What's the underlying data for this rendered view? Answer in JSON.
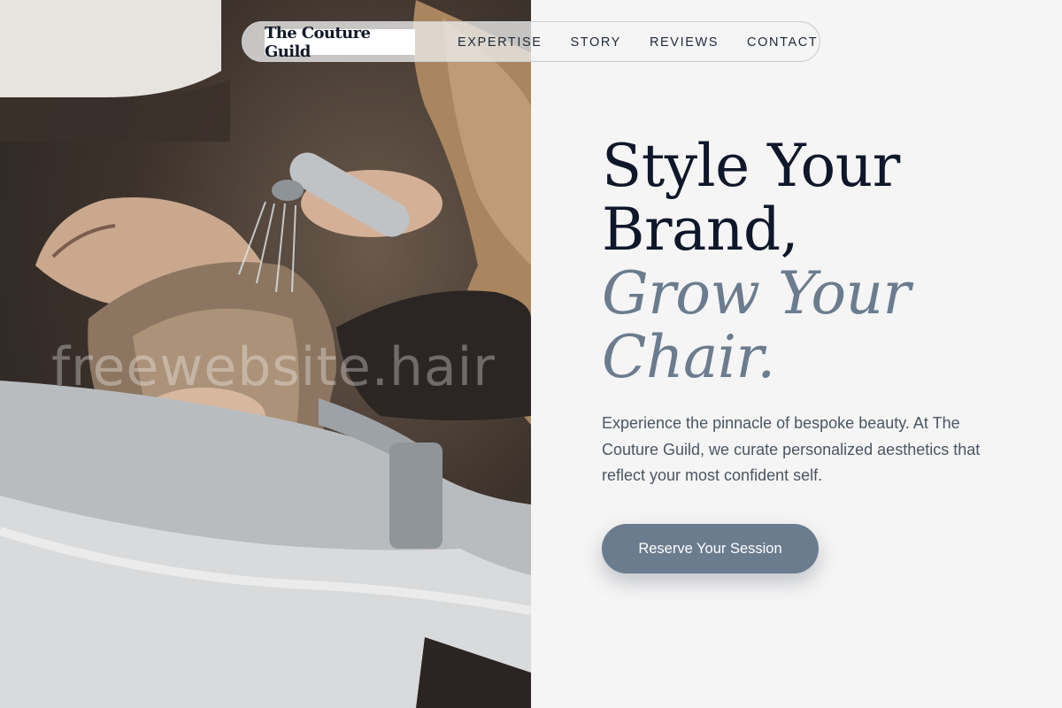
{
  "brand": {
    "name": "The Couture Guild"
  },
  "nav": {
    "links": [
      "EXPERTISE",
      "STORY",
      "REVIEWS",
      "CONTACT"
    ]
  },
  "hero": {
    "headline_line1": "Style Your",
    "headline_line2": "Brand,",
    "headline_accent_line1": "Grow Your",
    "headline_accent_line2": "Chair.",
    "description": "Experience the pinnacle of bespoke beauty. At The Couture Guild, we curate personalized aesthetics that reflect your most confident self.",
    "cta_label": "Reserve Your Session",
    "image_watermark": "freewebsite.hair"
  },
  "colors": {
    "accent": "#6b7c8f",
    "heading": "#0f172a",
    "body_text": "#4b5563",
    "background": "#f5f5f5"
  }
}
